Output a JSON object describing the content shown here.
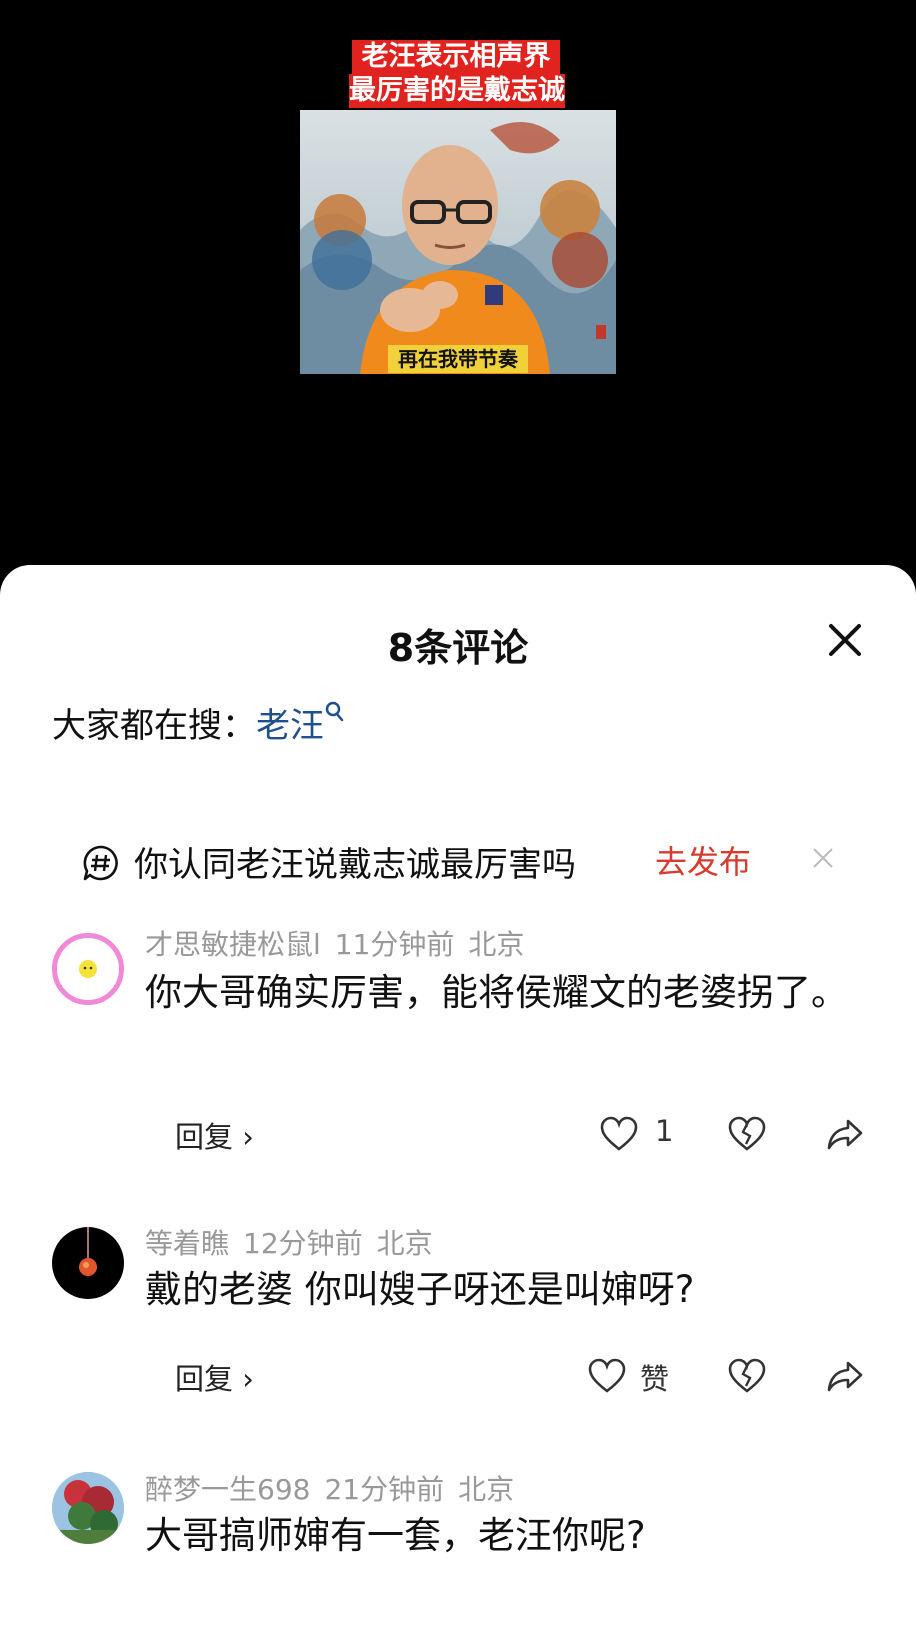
{
  "video": {
    "title_line1": "老汪表示相声界",
    "title_line2": "最厉害的是戴志诚",
    "caption": "再在我带节奏"
  },
  "sheet": {
    "title": "8条评论"
  },
  "search_hint": {
    "label": "大家都在搜：",
    "keyword": "老汪"
  },
  "topic": {
    "text": "你认同老汪说戴志诚最厉害吗",
    "publish_label": "去发布"
  },
  "comments": [
    {
      "user": "才思敏捷松鼠l",
      "time": "11分钟前",
      "location": "北京",
      "text": "你大哥确实厉害，能将侯耀文的老婆拐了。",
      "reply_label": "回复 ›",
      "likes": "1"
    },
    {
      "user": "等着瞧",
      "time": "12分钟前",
      "location": "北京",
      "text": "戴的老婆 你叫嫂子呀还是叫婶呀?",
      "reply_label": "回复 ›",
      "likes": "赞"
    },
    {
      "user": "醉梦一生698",
      "time": "21分钟前",
      "location": "北京",
      "text": "大哥搞师婶有一套，老汪你呢?"
    }
  ],
  "colors": {
    "publish_red": "#d93a2f",
    "keyword_blue": "#1f4f8f",
    "title_banner_red": "#e0231f",
    "caption_yellow": "#f1d13a"
  }
}
